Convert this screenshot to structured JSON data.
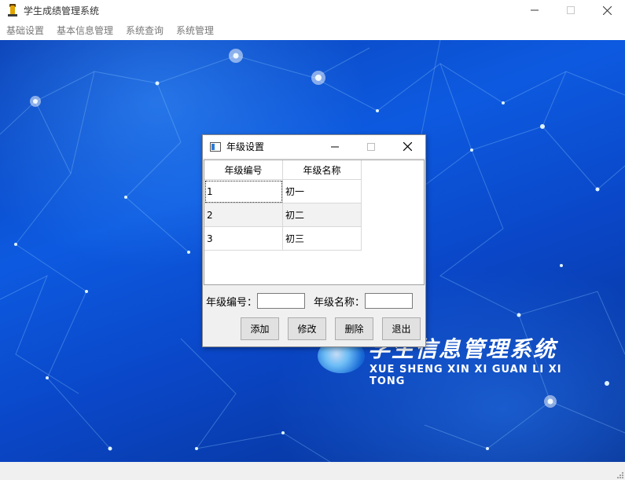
{
  "window": {
    "title": "学生成绩管理系统"
  },
  "menu": {
    "items": [
      "基础设置",
      "基本信息管理",
      "系统查询",
      "系统管理"
    ]
  },
  "background": {
    "logo_title": "学生信息管理系统",
    "logo_subtitle": "XUE SHENG XIN XI GUAN LI XI TONG"
  },
  "dialog": {
    "title": "年级设置",
    "columns": [
      "年级编号",
      "年级名称"
    ],
    "rows": [
      [
        "1",
        "初一"
      ],
      [
        "2",
        "初二"
      ],
      [
        "3",
        "初三"
      ]
    ],
    "form": {
      "grade_id_label": "年级编号：",
      "grade_id_value": "",
      "grade_name_label": "年级名称：",
      "grade_name_value": ""
    },
    "buttons": {
      "add": "添加",
      "edit": "修改",
      "delete": "删除",
      "exit": "退出"
    }
  },
  "colors": {
    "accent": "#0d5ae0",
    "dialog_bg": "#f0f0f0",
    "menu_text": "#777777"
  },
  "icons": [
    "app-icon",
    "minimize-icon",
    "maximize-icon",
    "close-icon",
    "dialog-icon",
    "resize-grip-icon"
  ]
}
